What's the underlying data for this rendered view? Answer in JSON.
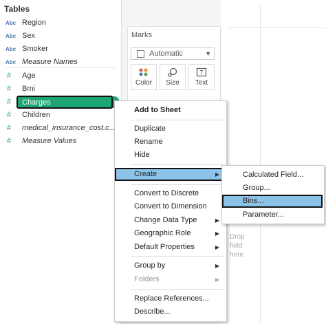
{
  "data_pane": {
    "title": "Tables",
    "fields": [
      {
        "type": "Abc",
        "name": "Region",
        "italic": false
      },
      {
        "type": "Abc",
        "name": "Sex",
        "italic": false
      },
      {
        "type": "Abc",
        "name": "Smoker",
        "italic": false
      },
      {
        "type": "Abc",
        "name": "Measure Names",
        "italic": true
      },
      {
        "type": "#",
        "name": "Age",
        "italic": false
      },
      {
        "type": "#",
        "name": "Bmi",
        "italic": false
      },
      {
        "type": "#",
        "name": "Charges",
        "italic": false
      },
      {
        "type": "#",
        "name": "Children",
        "italic": false
      },
      {
        "type": "#",
        "name": "medical_insurance_cost.c...",
        "italic": true
      },
      {
        "type": "#",
        "name": "Measure Values",
        "italic": true
      }
    ],
    "selected_color": "#1da673"
  },
  "marks": {
    "title": "Marks",
    "mark_type": "Automatic",
    "buttons": [
      {
        "label": "Color",
        "icon": "color-dots-icon"
      },
      {
        "label": "Size",
        "icon": "size-icon"
      },
      {
        "label": "Text",
        "icon": "text-icon"
      }
    ]
  },
  "view": {
    "drop_hint": "Drop field here"
  },
  "context_menu": {
    "items": [
      {
        "label": "Add to Sheet",
        "bold": true
      },
      {
        "label": "Duplicate"
      },
      {
        "label": "Rename"
      },
      {
        "label": "Hide"
      },
      {
        "label": "Create",
        "submenu": true,
        "highlighted": true
      },
      {
        "label": "Convert to Discrete"
      },
      {
        "label": "Convert to Dimension"
      },
      {
        "label": "Change Data Type",
        "submenu": true
      },
      {
        "label": "Geographic Role",
        "submenu": true
      },
      {
        "label": "Default Properties",
        "submenu": true
      },
      {
        "label": "Group by",
        "submenu": true
      },
      {
        "label": "Folders",
        "submenu": true,
        "disabled": true
      },
      {
        "label": "Replace References..."
      },
      {
        "label": "Describe..."
      }
    ],
    "highlight_color": "#8ec3e9"
  },
  "create_submenu": {
    "items": [
      {
        "label": "Calculated Field..."
      },
      {
        "label": "Group..."
      },
      {
        "label": "Bins...",
        "highlighted": true
      },
      {
        "label": "Parameter..."
      }
    ]
  }
}
